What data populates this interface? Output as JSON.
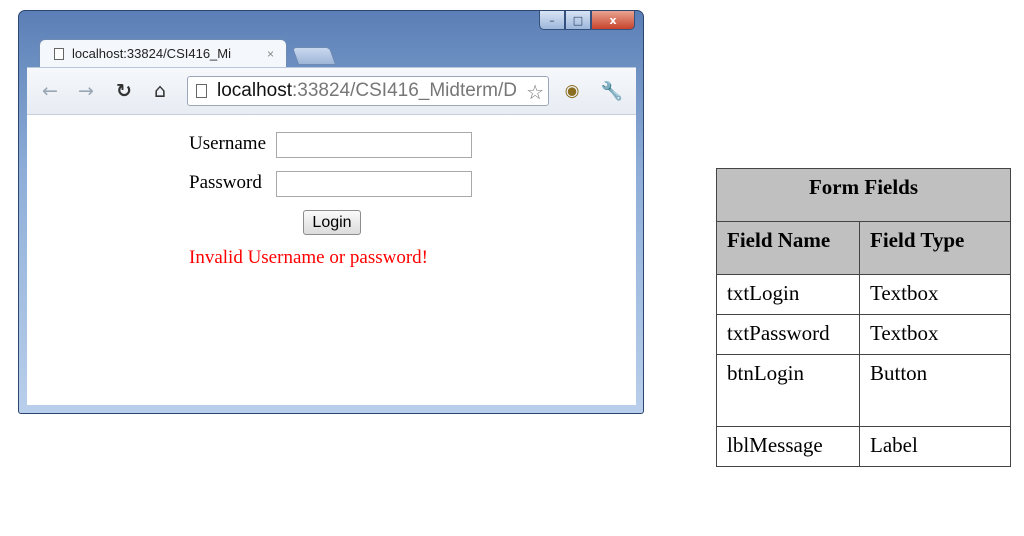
{
  "browser": {
    "tab_title": "localhost:33824/CSI416_Mi",
    "tab_close": "×",
    "window_controls": {
      "minimize": "–",
      "maximize": "□",
      "close": "x"
    },
    "toolbar_icons": [
      "back-arrow-icon",
      "forward-arrow-icon",
      "reload-icon",
      "home-icon",
      "page-icon",
      "star-icon",
      "eye-icon",
      "wrench-icon"
    ],
    "address": {
      "host": "localhost",
      "rest": ":33824/CSI416_Midterm/D"
    }
  },
  "page": {
    "username_label": "Username",
    "password_label": "Password",
    "username_value": "",
    "password_value": "",
    "login_button": "Login",
    "message": "Invalid Username or password!",
    "message_color": "#ff0000"
  },
  "fields_table": {
    "title": "Form Fields",
    "headers": [
      "Field Name",
      "Field Type"
    ],
    "rows": [
      {
        "name": "txtLogin",
        "type": "Textbox"
      },
      {
        "name": "txtPassword",
        "type": "Textbox"
      },
      {
        "name": "btnLogin",
        "type": "Button"
      },
      {
        "name": "lblMessage",
        "type": "Label"
      }
    ]
  }
}
